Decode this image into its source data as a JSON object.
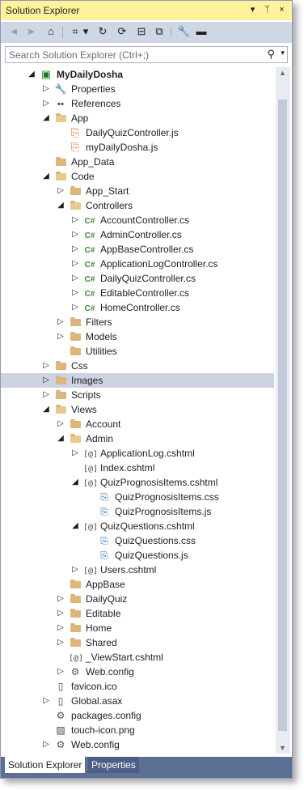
{
  "window": {
    "title": "Solution Explorer",
    "buttons": [
      {
        "name": "window-position-button",
        "glyph": "▾"
      },
      {
        "name": "pin-button",
        "glyph": "ᛘ"
      },
      {
        "name": "close-button",
        "glyph": "×"
      }
    ]
  },
  "toolbar": {
    "tools": [
      {
        "name": "back-icon",
        "glyph": "◄",
        "dim": true
      },
      {
        "name": "forward-icon",
        "glyph": "►",
        "dim": true
      },
      {
        "name": "home-icon",
        "glyph": "⌂"
      },
      {
        "name": "pending-changes-filter-icon",
        "glyph": "⌗"
      },
      {
        "name": "dropdown-icon",
        "glyph": "▾"
      },
      {
        "name": "sync-icon",
        "glyph": "↻"
      },
      {
        "name": "refresh-icon",
        "glyph": "⟳"
      },
      {
        "name": "collapse-all-icon",
        "glyph": "⊟"
      },
      {
        "name": "show-all-files-icon",
        "glyph": "⧉"
      },
      {
        "name": "properties-icon",
        "glyph": "🔧"
      },
      {
        "name": "preview-icon",
        "glyph": "▬"
      }
    ]
  },
  "search": {
    "placeholder": "Search Solution Explorer (Ctrl+;)",
    "icon": "search-icon"
  },
  "tree": [
    {
      "label": "MyDailyDosha",
      "level": 0,
      "exp": "open",
      "icon": "project",
      "bold": true
    },
    {
      "label": "Properties",
      "level": 1,
      "exp": "closed",
      "icon": "wrench"
    },
    {
      "label": "References",
      "level": 1,
      "exp": "closed",
      "icon": "references"
    },
    {
      "label": "App",
      "level": 1,
      "exp": "open",
      "icon": "folder-open"
    },
    {
      "label": "DailyQuizController.js",
      "level": 2,
      "exp": "",
      "icon": "js"
    },
    {
      "label": "myDailyDosha.js",
      "level": 2,
      "exp": "",
      "icon": "js"
    },
    {
      "label": "App_Data",
      "level": 1,
      "exp": "",
      "icon": "folder"
    },
    {
      "label": "Code",
      "level": 1,
      "exp": "open",
      "icon": "folder-open"
    },
    {
      "label": "App_Start",
      "level": 2,
      "exp": "closed",
      "icon": "folder"
    },
    {
      "label": "Controllers",
      "level": 2,
      "exp": "open",
      "icon": "folder-open"
    },
    {
      "label": "AccountController.cs",
      "level": 3,
      "exp": "closed",
      "icon": "cs"
    },
    {
      "label": "AdminController.cs",
      "level": 3,
      "exp": "closed",
      "icon": "cs"
    },
    {
      "label": "AppBaseController.cs",
      "level": 3,
      "exp": "closed",
      "icon": "cs"
    },
    {
      "label": "ApplicationLogController.cs",
      "level": 3,
      "exp": "closed",
      "icon": "cs"
    },
    {
      "label": "DailyQuizController.cs",
      "level": 3,
      "exp": "closed",
      "icon": "cs"
    },
    {
      "label": "EditableController.cs",
      "level": 3,
      "exp": "closed",
      "icon": "cs"
    },
    {
      "label": "HomeController.cs",
      "level": 3,
      "exp": "closed",
      "icon": "cs"
    },
    {
      "label": "Filters",
      "level": 2,
      "exp": "closed",
      "icon": "folder"
    },
    {
      "label": "Models",
      "level": 2,
      "exp": "closed",
      "icon": "folder"
    },
    {
      "label": "Utilities",
      "level": 2,
      "exp": "",
      "icon": "folder"
    },
    {
      "label": "Css",
      "level": 1,
      "exp": "closed",
      "icon": "folder"
    },
    {
      "label": "Images",
      "level": 1,
      "exp": "closed",
      "icon": "folder",
      "selected": true
    },
    {
      "label": "Scripts",
      "level": 1,
      "exp": "closed",
      "icon": "folder"
    },
    {
      "label": "Views",
      "level": 1,
      "exp": "open",
      "icon": "folder-open"
    },
    {
      "label": "Account",
      "level": 2,
      "exp": "closed",
      "icon": "folder"
    },
    {
      "label": "Admin",
      "level": 2,
      "exp": "open",
      "icon": "folder-open"
    },
    {
      "label": "ApplicationLog.cshtml",
      "level": 3,
      "exp": "closed",
      "icon": "razor"
    },
    {
      "label": "Index.cshtml",
      "level": 3,
      "exp": "",
      "icon": "razor"
    },
    {
      "label": "QuizPrognosisItems.cshtml",
      "level": 3,
      "exp": "open",
      "icon": "razor"
    },
    {
      "label": "QuizPrognosisItems.css",
      "level": 4,
      "exp": "",
      "icon": "css"
    },
    {
      "label": "QuizPrognosisItems.js",
      "level": 4,
      "exp": "",
      "icon": "css"
    },
    {
      "label": "QuizQuestions.cshtml",
      "level": 3,
      "exp": "open",
      "icon": "razor"
    },
    {
      "label": "QuizQuestions.css",
      "level": 4,
      "exp": "",
      "icon": "css"
    },
    {
      "label": "QuizQuestions.js",
      "level": 4,
      "exp": "",
      "icon": "css"
    },
    {
      "label": "Users.cshtml",
      "level": 3,
      "exp": "closed",
      "icon": "razor"
    },
    {
      "label": "AppBase",
      "level": 2,
      "exp": "",
      "icon": "folder"
    },
    {
      "label": "DailyQuiz",
      "level": 2,
      "exp": "closed",
      "icon": "folder"
    },
    {
      "label": "Editable",
      "level": 2,
      "exp": "closed",
      "icon": "folder"
    },
    {
      "label": "Home",
      "level": 2,
      "exp": "closed",
      "icon": "folder"
    },
    {
      "label": "Shared",
      "level": 2,
      "exp": "closed",
      "icon": "folder"
    },
    {
      "label": "_ViewStart.cshtml",
      "level": 2,
      "exp": "",
      "icon": "razor"
    },
    {
      "label": "Web.config",
      "level": 2,
      "exp": "closed",
      "icon": "config"
    },
    {
      "label": "favicon.ico",
      "level": 1,
      "exp": "",
      "icon": "generic"
    },
    {
      "label": "Global.asax",
      "level": 1,
      "exp": "closed",
      "icon": "generic"
    },
    {
      "label": "packages.config",
      "level": 1,
      "exp": "",
      "icon": "config"
    },
    {
      "label": "touch-icon.png",
      "level": 1,
      "exp": "",
      "icon": "image"
    },
    {
      "label": "Web.config",
      "level": 1,
      "exp": "closed",
      "icon": "config"
    }
  ],
  "tabs": [
    {
      "label": "Solution Explorer",
      "active": true
    },
    {
      "label": "Properties",
      "active": false
    }
  ],
  "colors": {
    "title_bar": "#fff29d",
    "toolbar": "#cfd6e5",
    "selection": "#cdd3e0",
    "tab_strip": "#5c6f94"
  }
}
